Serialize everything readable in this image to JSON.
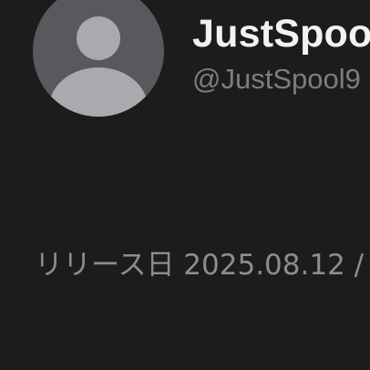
{
  "profile": {
    "display_name": "JustSpoo",
    "handle": "@JustSpool9",
    "avatar_icon": "default-user-avatar-icon",
    "avatar_background": "#58595c",
    "avatar_figure": "#a9aaad"
  },
  "release": {
    "label": "リリース日 2025.08.12 /"
  },
  "colors": {
    "background": "#1c1c1c",
    "name_text": "#f2f2f2",
    "handle_text": "#7d7d7d",
    "release_text": "#8d8d8d"
  }
}
